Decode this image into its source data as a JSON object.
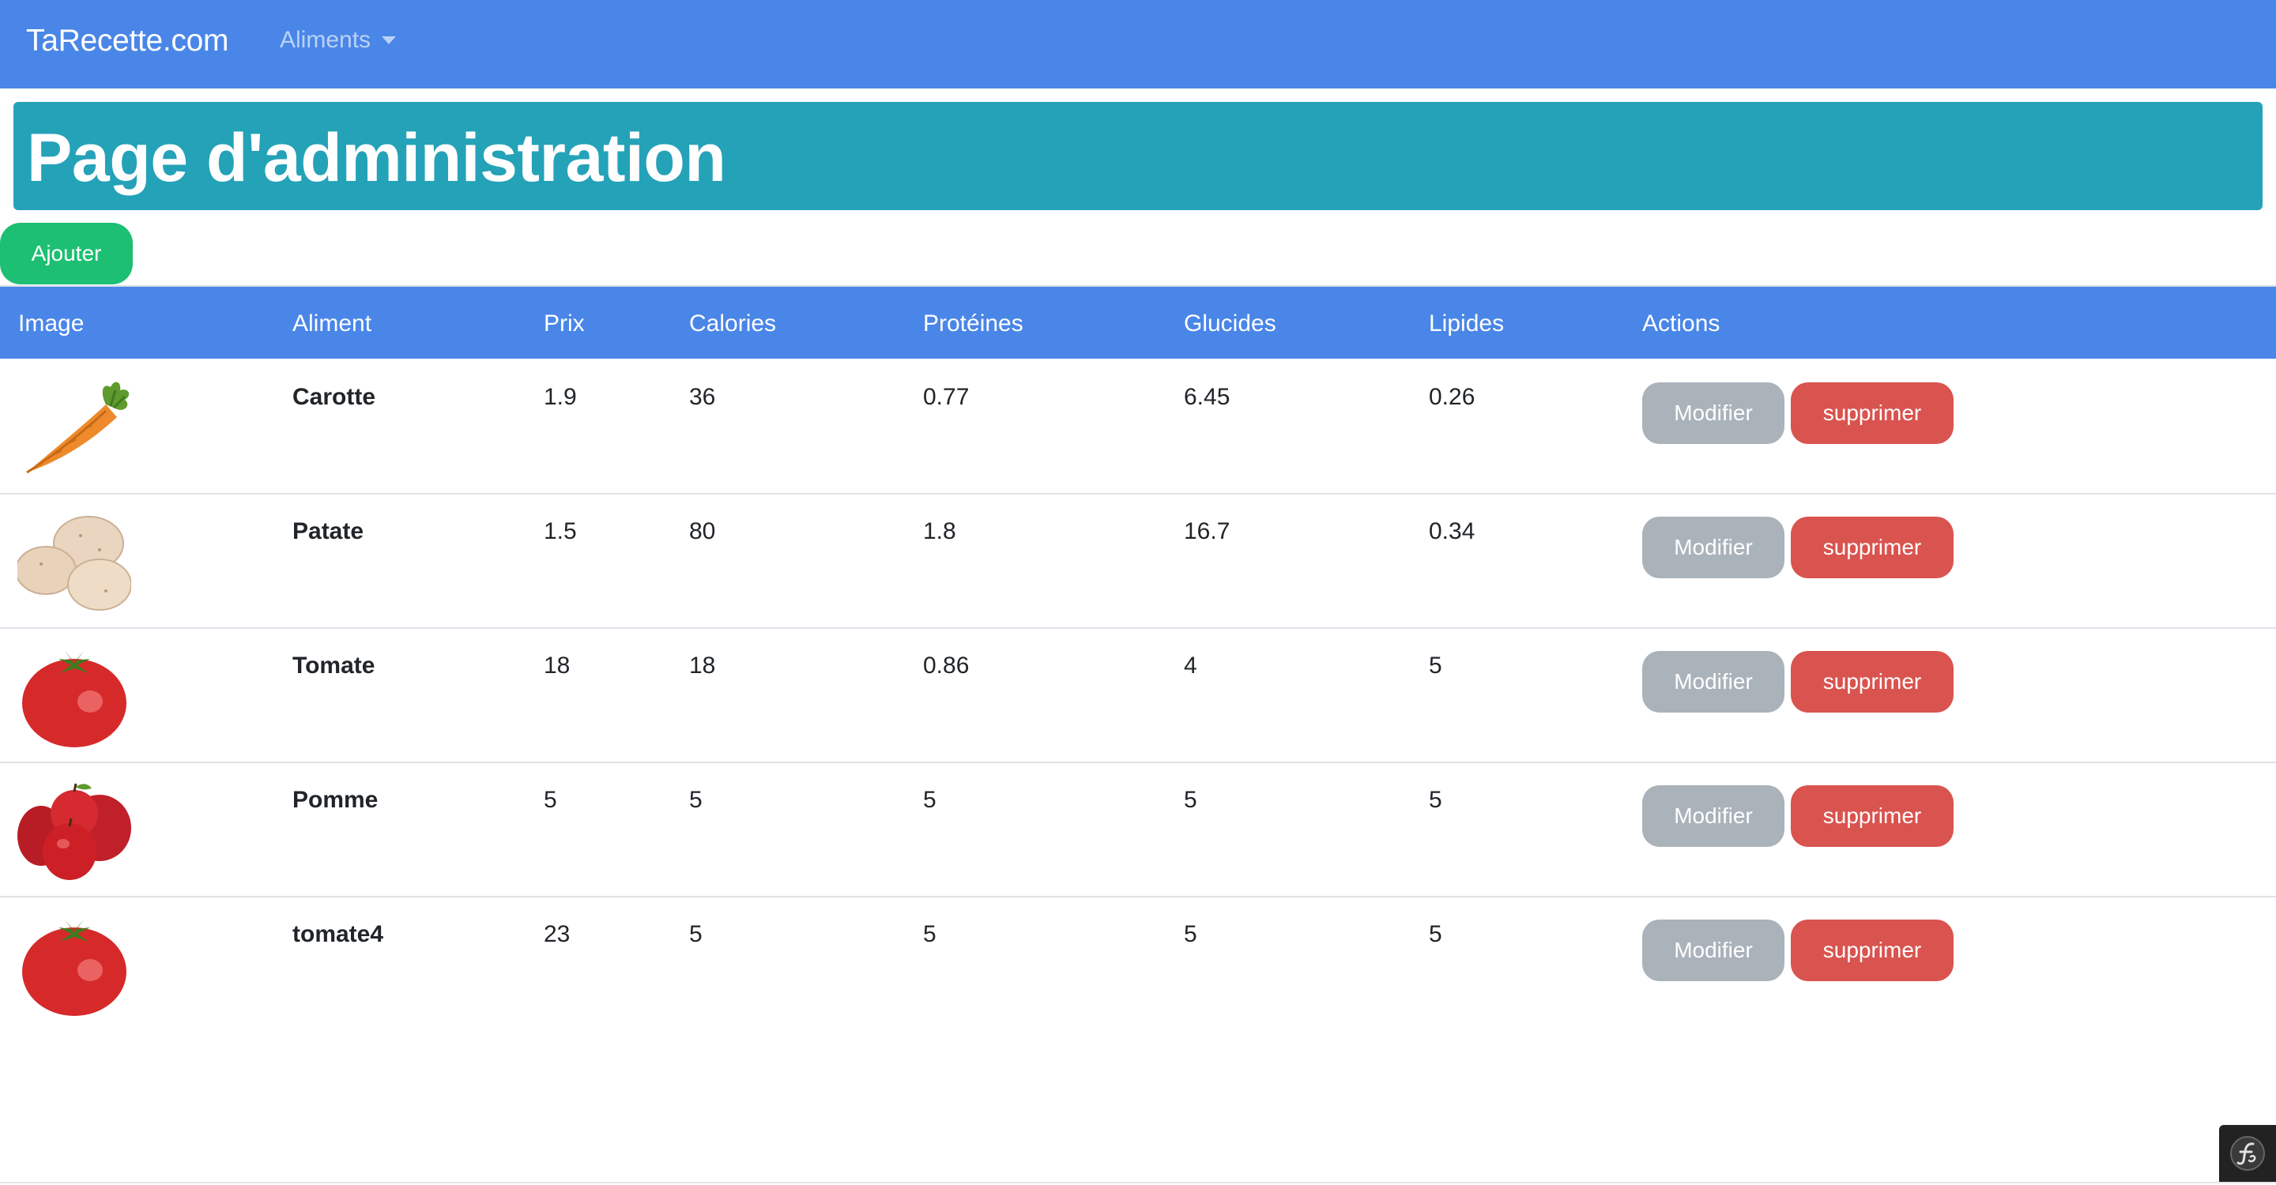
{
  "navbar": {
    "brand": "TaRecette.com",
    "dropdown_label": "Aliments"
  },
  "header": {
    "title": "Page d'administration"
  },
  "actions": {
    "add_label": "Ajouter"
  },
  "table": {
    "columns": [
      "Image",
      "Aliment",
      "Prix",
      "Calories",
      "Protéines",
      "Glucides",
      "Lipides",
      "Actions"
    ],
    "rows": [
      {
        "image": "carrot-image",
        "name": "Carotte",
        "prix": "1.9",
        "calories": "36",
        "proteines": "0.77",
        "glucides": "6.45",
        "lipides": "0.26",
        "edit": "Modifier",
        "delete": "supprimer"
      },
      {
        "image": "potato-image",
        "name": "Patate",
        "prix": "1.5",
        "calories": "80",
        "proteines": "1.8",
        "glucides": "16.7",
        "lipides": "0.34",
        "edit": "Modifier",
        "delete": "supprimer"
      },
      {
        "image": "tomato-image",
        "name": "Tomate",
        "prix": "18",
        "calories": "18",
        "proteines": "0.86",
        "glucides": "4",
        "lipides": "5",
        "edit": "Modifier",
        "delete": "supprimer"
      },
      {
        "image": "apple-image",
        "name": "Pomme",
        "prix": "5",
        "calories": "5",
        "proteines": "5",
        "glucides": "5",
        "lipides": "5",
        "edit": "Modifier",
        "delete": "supprimer"
      },
      {
        "image": "tomato-image",
        "name": "tomate4",
        "prix": "23",
        "calories": "5",
        "proteines": "5",
        "glucides": "5",
        "lipides": "5",
        "edit": "Modifier",
        "delete": "supprimer"
      }
    ]
  },
  "colors": {
    "navbar": "#4a86e8",
    "jumbotron": "#24a2b8",
    "add_button": "#1dbf73",
    "edit_button": "#aab2ba",
    "delete_button": "#d9534f"
  },
  "debug_toolbar": {
    "icon": "symfony-icon"
  }
}
